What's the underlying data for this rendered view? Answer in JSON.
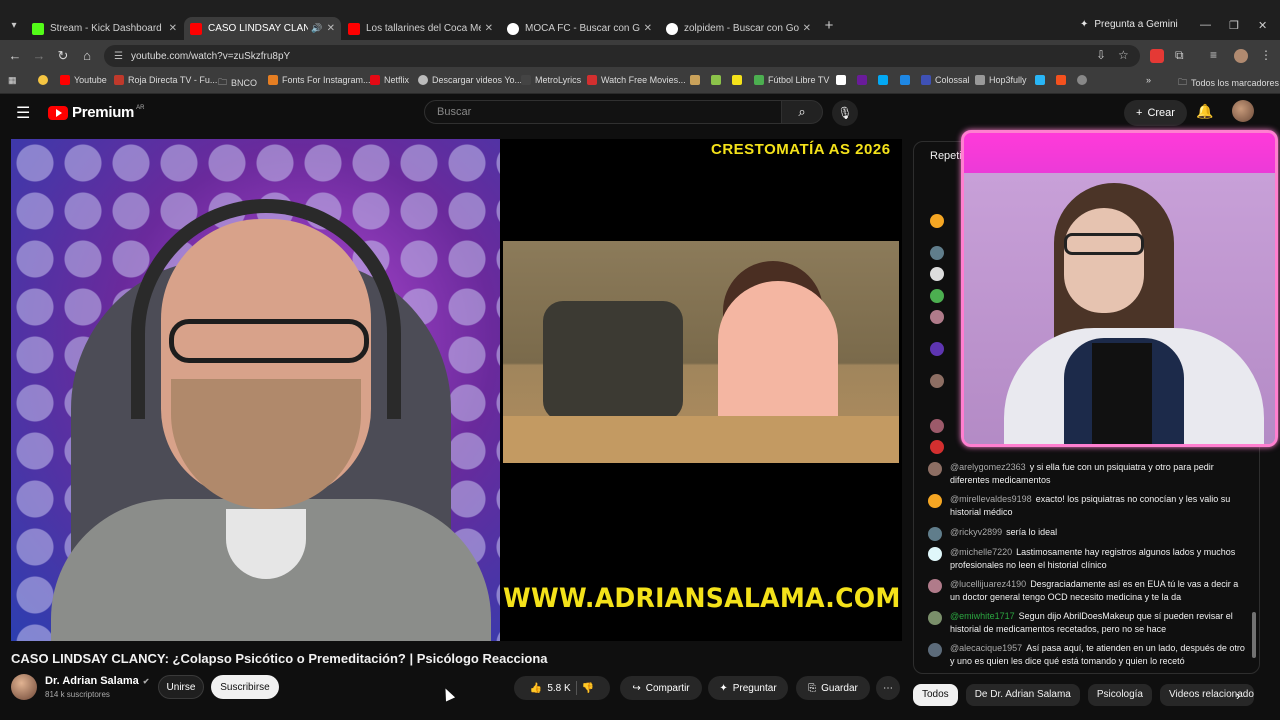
{
  "browser": {
    "tabs": [
      {
        "label": "Stream - Kick Dashboard",
        "color": "#53fc18",
        "active": false
      },
      {
        "label": "CASO LINDSAY CLANCY: ¿C",
        "color": "#ff0000",
        "active": true,
        "audio": true
      },
      {
        "label": "Los tallarines del Coca Mendoza",
        "color": "#ff0000",
        "active": false
      },
      {
        "label": "MOCA FC - Buscar con Google",
        "color": "#ffffff",
        "active": false
      },
      {
        "label": "zolpidem - Buscar con Google",
        "color": "#ffffff",
        "active": false
      }
    ],
    "gemini_label": "Pregunta a Gemini",
    "url": "youtube.com/watch?v=zuSkzfru8pY",
    "bookmarks": [
      {
        "label": "",
        "color": "#f5c542"
      },
      {
        "label": "Youtube",
        "color": "#ff0000"
      },
      {
        "label": "Roja Directa TV - Fu...",
        "color": "#c0392b"
      },
      {
        "label": "BNCO",
        "color": "#999999"
      },
      {
        "label": "Fonts For Instagram...",
        "color": "#e67e22"
      },
      {
        "label": "Netflix",
        "color": "#e50914"
      },
      {
        "label": "Descargar videos Yo...",
        "color": "#bbbbbb"
      },
      {
        "label": "MetroLyrics",
        "color": "#444444"
      },
      {
        "label": "Watch Free Movies...",
        "color": "#d32f2f"
      },
      {
        "label": "Fútbol Libre TV",
        "color": "#4caf50"
      },
      {
        "label": "Colossal",
        "color": "#3f51b5"
      },
      {
        "label": "Hop3fully",
        "color": "#999999"
      }
    ],
    "all_bookmarks": "Todos los marcadores"
  },
  "youtube": {
    "logo_word": "Premium",
    "logo_region": "AR",
    "search_placeholder": "Buscar",
    "create_label": "Crear"
  },
  "video": {
    "overlay_top": "CRESTOMATÍA AS 2026",
    "overlay_bottom": "WWW.ADRIANSALAMA.COM",
    "title": "CASO LINDSAY CLANCY: ¿Colapso Psicótico o Premeditación? | Psicólogo Reacciona",
    "channel": "Dr. Adrian Salama",
    "subscribers": "814 k suscriptores",
    "join_label": "Unirse",
    "subscribe_label": "Suscribirse",
    "likes": "5.8 K",
    "share_label": "Compartir",
    "ask_label": "Preguntar",
    "save_label": "Guardar"
  },
  "chat": {
    "header": "Repetición del chat en directo",
    "messages": [
      {
        "user": "@arelygomez2363",
        "text": "y si ella fue con un psiquiatra y otro para pedir diferentes medicamentos",
        "color": "#8d6e63",
        "member": false
      },
      {
        "user": "@mirellevaldes9198",
        "text": "exacto! los psiquiatras no conocían y les valio su historial médico",
        "color": "#f5a623",
        "member": false
      },
      {
        "user": "@rickyv2899",
        "text": "sería lo ideal",
        "color": "#607d8b",
        "member": false
      },
      {
        "user": "@michelle7220",
        "text": "Lastimosamente hay registros algunos lados y muchos profesionales no leen el historial clínico",
        "color": "#e0f7fa",
        "member": false
      },
      {
        "user": "@lucellijuarez4190",
        "text": "Desgraciadamente así es en EUA tú le vas a decir a un doctor general tengo OCD necesito medicina y te la da",
        "color": "#b07b8a",
        "member": false
      },
      {
        "user": "@emiwhite1717",
        "text": "Segun dijo AbrilDoesMakeup que sí pueden revisar el historial de medicamentos recetados, pero no se hace",
        "color": "#7a8f6a",
        "member": true
      },
      {
        "user": "@alecacique1957",
        "text": "Así pasa aquí, te atienden en un lado, después de otro y uno es quien les dice qué está tomando y quien lo recetó",
        "color": "#5c6b7a",
        "member": false
      }
    ]
  },
  "chips": [
    "Todos",
    "De Dr. Adrian Salama",
    "Psicología",
    "Videos relacionados"
  ]
}
